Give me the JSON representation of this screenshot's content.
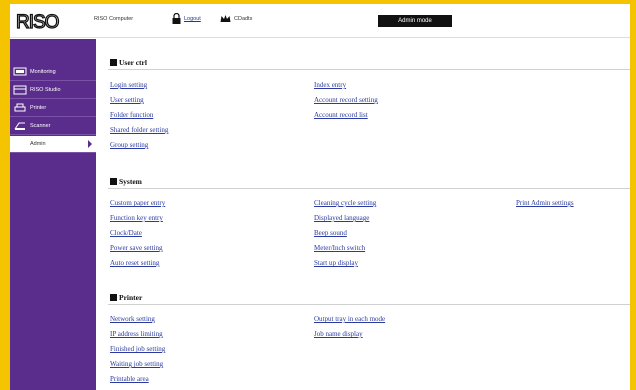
{
  "header": {
    "logo_text": "RISO",
    "printer_name": "RISO Computer",
    "logout_label": "Logout",
    "user_label": "CDadts",
    "mode_label": "Admin mode"
  },
  "sidebar": {
    "items": [
      {
        "label": "Monitoring",
        "icon": "monitor-icon"
      },
      {
        "label": "RISO Studio",
        "icon": "studio-icon"
      },
      {
        "label": "Printer",
        "icon": "printer-icon"
      },
      {
        "label": "Scanner",
        "icon": "scanner-icon"
      },
      {
        "label": "Admin",
        "icon": "arrow-right-icon"
      }
    ]
  },
  "sections": {
    "user_ctrl": {
      "title": "User ctrl",
      "col1": [
        "Login setting",
        "User setting",
        "Folder function",
        "Shared folder setting",
        "Group setting"
      ],
      "col2": [
        "Index entry",
        "Account record setting",
        "Account record list"
      ]
    },
    "system": {
      "title": "System",
      "col1": [
        "Custom paper entry",
        "Function key entry",
        "Clock/Date",
        "Power save setting",
        "Auto reset setting"
      ],
      "col2": [
        "Cleaning cycle setting",
        "Displayed language",
        "Beep sound",
        "Meter/Inch switch",
        "Start up display"
      ],
      "col3": [
        "Print Admin settings"
      ]
    },
    "printer": {
      "title": "Printer",
      "col1": [
        "Network setting",
        "IP address limiting",
        "Finished job setting",
        "Waiting job setting",
        "Printable area"
      ],
      "col2": [
        "Output tray in each mode",
        "Job name display"
      ]
    }
  }
}
